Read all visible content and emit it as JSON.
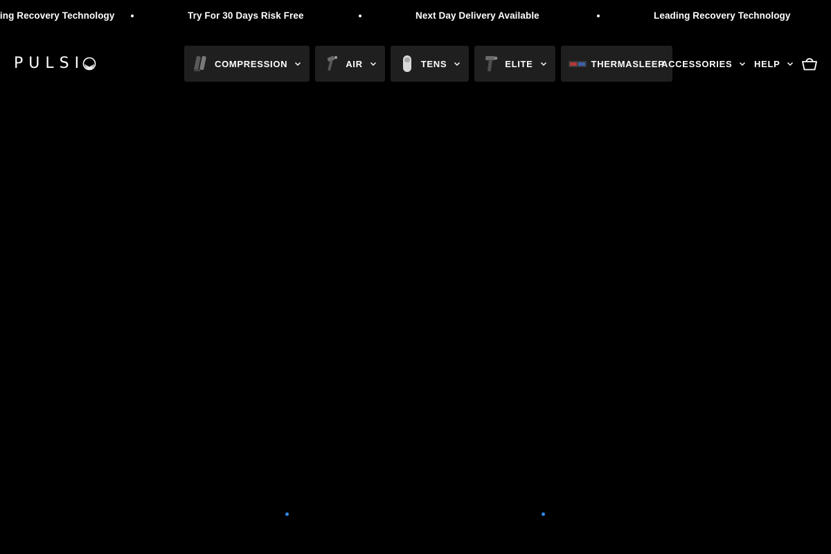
{
  "ticker": {
    "messages": [
      "Leading Recovery Technology",
      "Try For 30 Days Risk Free",
      "Next Day Delivery Available",
      "Leading Recovery Technology"
    ]
  },
  "header": {
    "logo_text": "PULSI",
    "nav": [
      {
        "label": "COMPRESSION",
        "thumb": "compression-boots-icon",
        "dropdown": true
      },
      {
        "label": "AIR",
        "thumb": "massage-gun-icon",
        "dropdown": true
      },
      {
        "label": "TENS",
        "thumb": "tens-unit-icon",
        "dropdown": true
      },
      {
        "label": "ELITE",
        "thumb": "massage-gun-icon",
        "dropdown": true
      },
      {
        "label": "THERMASLEEP",
        "thumb": "thermal-pad-icon",
        "dropdown": false
      }
    ],
    "accessories_label": "ACCESSORIES",
    "help_label": "HELP",
    "cart_icon": "cart-icon"
  },
  "hero": {
    "indicator_color": "#2d8cf0"
  }
}
